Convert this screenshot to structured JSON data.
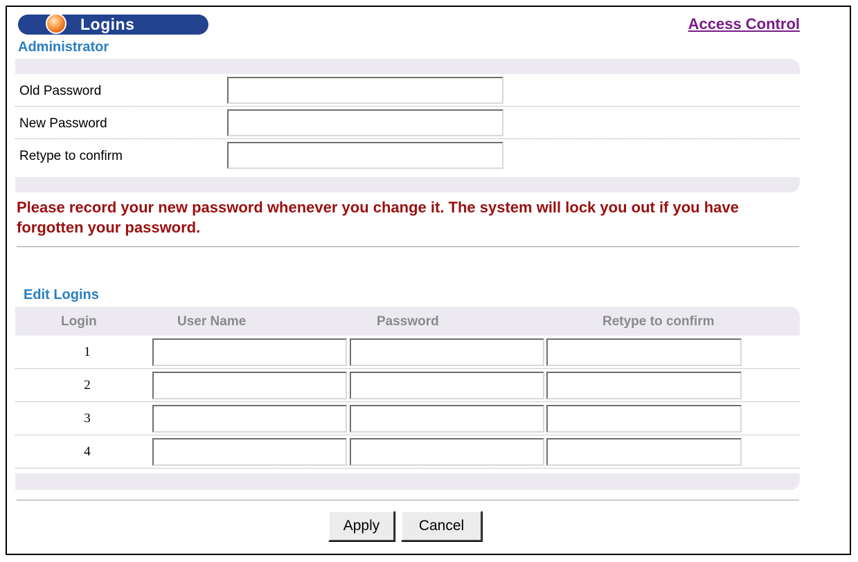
{
  "header": {
    "title": "Logins",
    "access_control_link": "Access Control"
  },
  "administrator": {
    "section_title": "Administrator",
    "fields": [
      {
        "label": "Old Password",
        "value": ""
      },
      {
        "label": "New Password",
        "value": ""
      },
      {
        "label": "Retype to confirm",
        "value": ""
      }
    ]
  },
  "warning_text": "Please record your new password whenever you change it. The system will lock you out if you have forgotten your password.",
  "edit_logins": {
    "section_title": "Edit Logins",
    "columns": [
      "Login",
      "User Name",
      "Password",
      "Retype to confirm"
    ],
    "rows": [
      {
        "login": "1",
        "user_name": "",
        "password": "",
        "retype": ""
      },
      {
        "login": "2",
        "user_name": "",
        "password": "",
        "retype": ""
      },
      {
        "login": "3",
        "user_name": "",
        "password": "",
        "retype": ""
      },
      {
        "login": "4",
        "user_name": "",
        "password": "",
        "retype": ""
      }
    ]
  },
  "buttons": {
    "apply": "Apply",
    "cancel": "Cancel"
  },
  "colors": {
    "title_pill": "#23428f",
    "section_title": "#2a7fc0",
    "warning": "#9b1010",
    "link": "#7a1a8a"
  }
}
